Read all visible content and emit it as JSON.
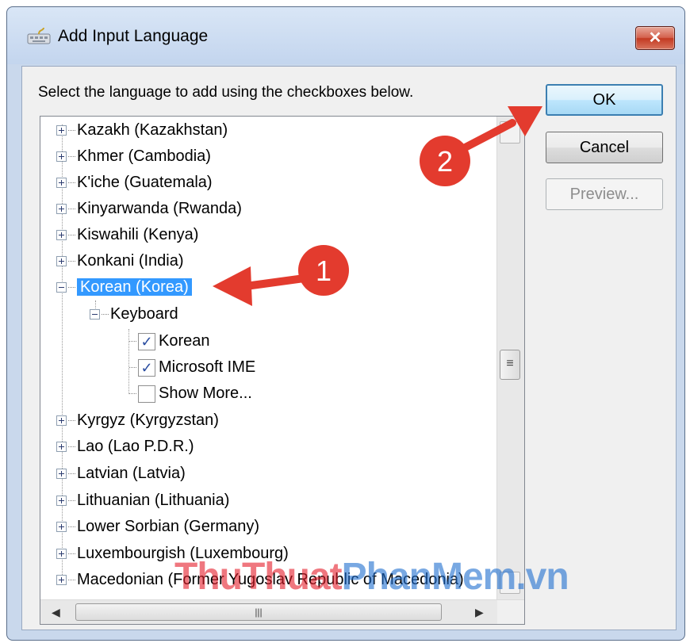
{
  "window": {
    "title": "Add Input Language",
    "close_label": "✕"
  },
  "instruction": "Select the language to add using the checkboxes below.",
  "buttons": {
    "ok": "OK",
    "cancel": "Cancel",
    "preview": "Preview..."
  },
  "tree": {
    "items_before": [
      "Kazakh (Kazakhstan)",
      "Khmer (Cambodia)",
      "K'iche (Guatemala)",
      "Kinyarwanda (Rwanda)",
      "Kiswahili (Kenya)",
      "Konkani (India)"
    ],
    "selected": "Korean (Korea)",
    "keyboard_label": "Keyboard",
    "keyboards": [
      {
        "label": "Korean",
        "checked": true
      },
      {
        "label": "Microsoft IME",
        "checked": true
      },
      {
        "label": "Show More...",
        "checked": false
      }
    ],
    "items_after": [
      "Kyrgyz (Kyrgyzstan)",
      "Lao (Lao P.D.R.)",
      "Latvian (Latvia)",
      "Lithuanian (Lithuania)",
      "Lower Sorbian (Germany)",
      "Luxembourgish (Luxembourg)",
      "Macedonian (Former Yugoslav Republic of Macedonia)"
    ]
  },
  "annotations": {
    "step1": "1",
    "step2": "2"
  },
  "watermark": {
    "part1": "ThuThuat",
    "part2": "PhanMem",
    "part3": ".vn"
  },
  "colors": {
    "selection": "#3399ff",
    "marker": "#e33b2e"
  }
}
